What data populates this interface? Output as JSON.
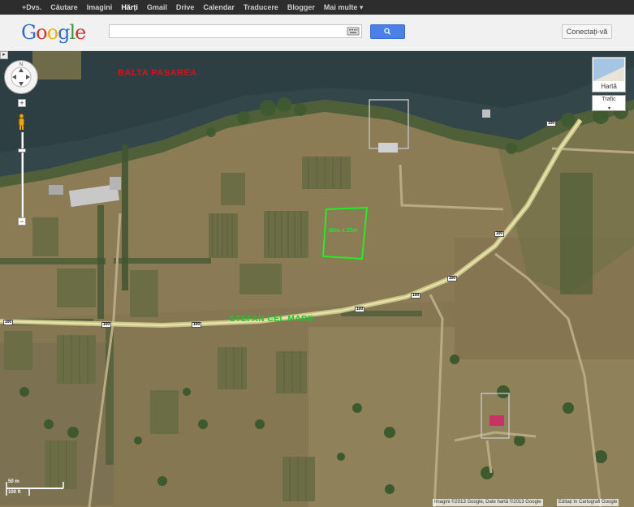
{
  "topbar": {
    "items": [
      "+Dvs.",
      "Căutare",
      "Imagini",
      "Hărți",
      "Gmail",
      "Drive",
      "Calendar",
      "Traducere",
      "Blogger",
      "Mai multe ▾"
    ],
    "active_index": 3
  },
  "header": {
    "logo_letters": [
      "G",
      "o",
      "o",
      "g",
      "l",
      "e"
    ],
    "search": {
      "value": "",
      "placeholder": ""
    },
    "search_button_icon": "search-icon",
    "keyboard_icon": "keyboard-icon",
    "signin_label": "Conectați-vă"
  },
  "map": {
    "lake_label": "BALTA PASAREA",
    "street_label": "STEFAN CEL MARE",
    "plot_label": "80m x 25m",
    "road_number": "100",
    "colors": {
      "lake_label": "#d8101a",
      "street_label": "#25c22d",
      "plot_outline": "#22ee22"
    }
  },
  "controls": {
    "pan_icon": "pan-control-icon",
    "zoom_in": "+",
    "zoom_out": "−",
    "pegman_icon": "pegman-icon",
    "maptype_label": "Hartă",
    "traffic_label": "Trafic",
    "collapse_icon": "collapse-arrow-icon",
    "collapse_glyph": "▸"
  },
  "scale": {
    "metric": "50 m",
    "imperial": "100 ft"
  },
  "attribution": "Imagini ©2013 Google, Date hartă ©2013 Google",
  "report_link": "Editați în Cartografi Google"
}
